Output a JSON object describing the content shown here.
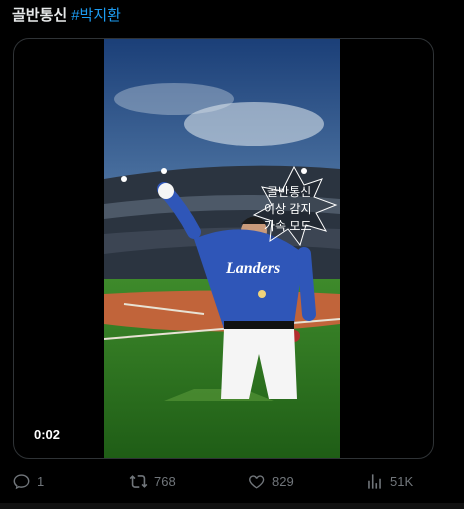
{
  "tweet": {
    "text": "골반통신",
    "hashtag": "#박지환"
  },
  "video": {
    "timestamp": "0:02",
    "overlay_text": [
      "골반통신",
      "이상 감지",
      "가속 모드"
    ],
    "jersey_text": "Landers"
  },
  "actions": {
    "reply": {
      "icon": "reply-icon",
      "count": "1"
    },
    "retweet": {
      "icon": "retweet-icon",
      "count": "768"
    },
    "like": {
      "icon": "heart-icon",
      "count": "829"
    },
    "views": {
      "icon": "views-icon",
      "count": "51K"
    }
  },
  "colors": {
    "hashtag": "#1d9bf0",
    "icon": "#71767b",
    "jersey": "#2f56b8"
  }
}
